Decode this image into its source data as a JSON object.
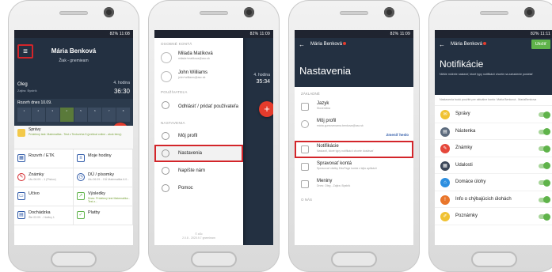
{
  "status_time": "82% 11:08",
  "screen1": {
    "name": "Mária Benková",
    "role": "Žiak - gnemieam",
    "city": "Oleg",
    "city_sub": "Zajtra: Bystrík",
    "hour_label": "4. hodina",
    "clock": "36:30",
    "schedule_label": "Rozvrh dnes 10.09.",
    "periods": [
      "1",
      "2",
      "3",
      "4",
      "5",
      "6",
      "7",
      "8"
    ],
    "news_title": "Správy",
    "news_text": "Prídelený test: Matematika - Test z Textoveha 5 (prelinal online - akok témy)",
    "menu_icon": "menu-icon",
    "grid": [
      {
        "label": "Rozvrh / ETK",
        "sub": ""
      },
      {
        "label": "Moje hodiny",
        "sub": ""
      },
      {
        "label": "Známky",
        "sub": "Utu 06.09. - 1 (Piskov)"
      },
      {
        "label": "DÚ / písomky",
        "sub": "Utu 06.09. - DÚ Matematika 6.0..."
      },
      {
        "label": "Učivo",
        "sub": ""
      },
      {
        "label": "Výsledky",
        "sub": "Dnes: Prídelený test Matematika - Test z..."
      },
      {
        "label": "Dochádzka",
        "sub": "Šte 03.09. - Hodiny 1"
      },
      {
        "label": "Platby",
        "sub": ""
      }
    ]
  },
  "screen2": {
    "time": "82% 11:09",
    "section_accounts": "OSOBNÉ KONTÁ",
    "accounts": [
      {
        "name": "Milada Matíková",
        "email": "milada+matikova@asc.sk"
      },
      {
        "name": "John Williams",
        "email": "john+williams@asc.sk"
      }
    ],
    "section_users": "POUŽÍVATEĽA",
    "logout": "Odhlásiť / pridať používateľa",
    "section_settings": "NASTAVENIA",
    "items": [
      "Môj profil",
      "Nastavenia",
      "Napíšte nám",
      "Pomoc"
    ],
    "version": "© aSc",
    "version2": "2.0.8 - 2020.9.7\ngnemieam",
    "right_hour": "4. hodina",
    "right_clock": "35:34"
  },
  "screen3": {
    "time": "82% 11:09",
    "who": "Mária Benková",
    "title": "Nastavenia",
    "section": "ZÁKLADNÉ",
    "rows": [
      {
        "title": "Jazyk",
        "sub": "Slovenčina"
      },
      {
        "title": "Môj profil",
        "sub": "mária.gumovenarna.benkova@asc.sk"
      },
      {
        "title": "Notifikácie",
        "sub": "Nastaviť, ktoré typy notifikácií chcete dostávať"
      },
      {
        "title": "Spravovať kontá",
        "sub": "Spravovať všetky EduPage kontá v tejto aplikácii"
      },
      {
        "title": "Meniny",
        "sub": "Dnes: Oleg - Zajtra: Bystrík"
      }
    ],
    "change_password": "Zmeniť heslo",
    "section_about": "O NÁS"
  },
  "screen4": {
    "time": "82% 11:11",
    "who": "Mária Benková",
    "save": "Uložiť",
    "title": "Notifikácie",
    "desc": "Nižšie môžete nastaviť, ktoré typy notifikácií chcete na zariadenie posielať",
    "note": "Nastavenia budú použité pre aktuálne konto: Mária Benková - MariaBenkova",
    "rows": [
      {
        "label": "Správy",
        "color": "#f0c233",
        "icon": "mail-icon"
      },
      {
        "label": "Nástenka",
        "color": "#5c6b7d",
        "icon": "board-icon"
      },
      {
        "label": "Známky",
        "color": "#e5483b",
        "icon": "grade-icon"
      },
      {
        "label": "Udalosti",
        "color": "#3a4658",
        "icon": "calendar-icon"
      },
      {
        "label": "Domáce úlohy",
        "color": "#2d8fe0",
        "icon": "homework-icon"
      },
      {
        "label": "Info o chýbajúcich úlohách",
        "color": "#e9762b",
        "icon": "alert-icon"
      },
      {
        "label": "Poznámky",
        "color": "#f0c233",
        "icon": "note-icon"
      }
    ]
  }
}
